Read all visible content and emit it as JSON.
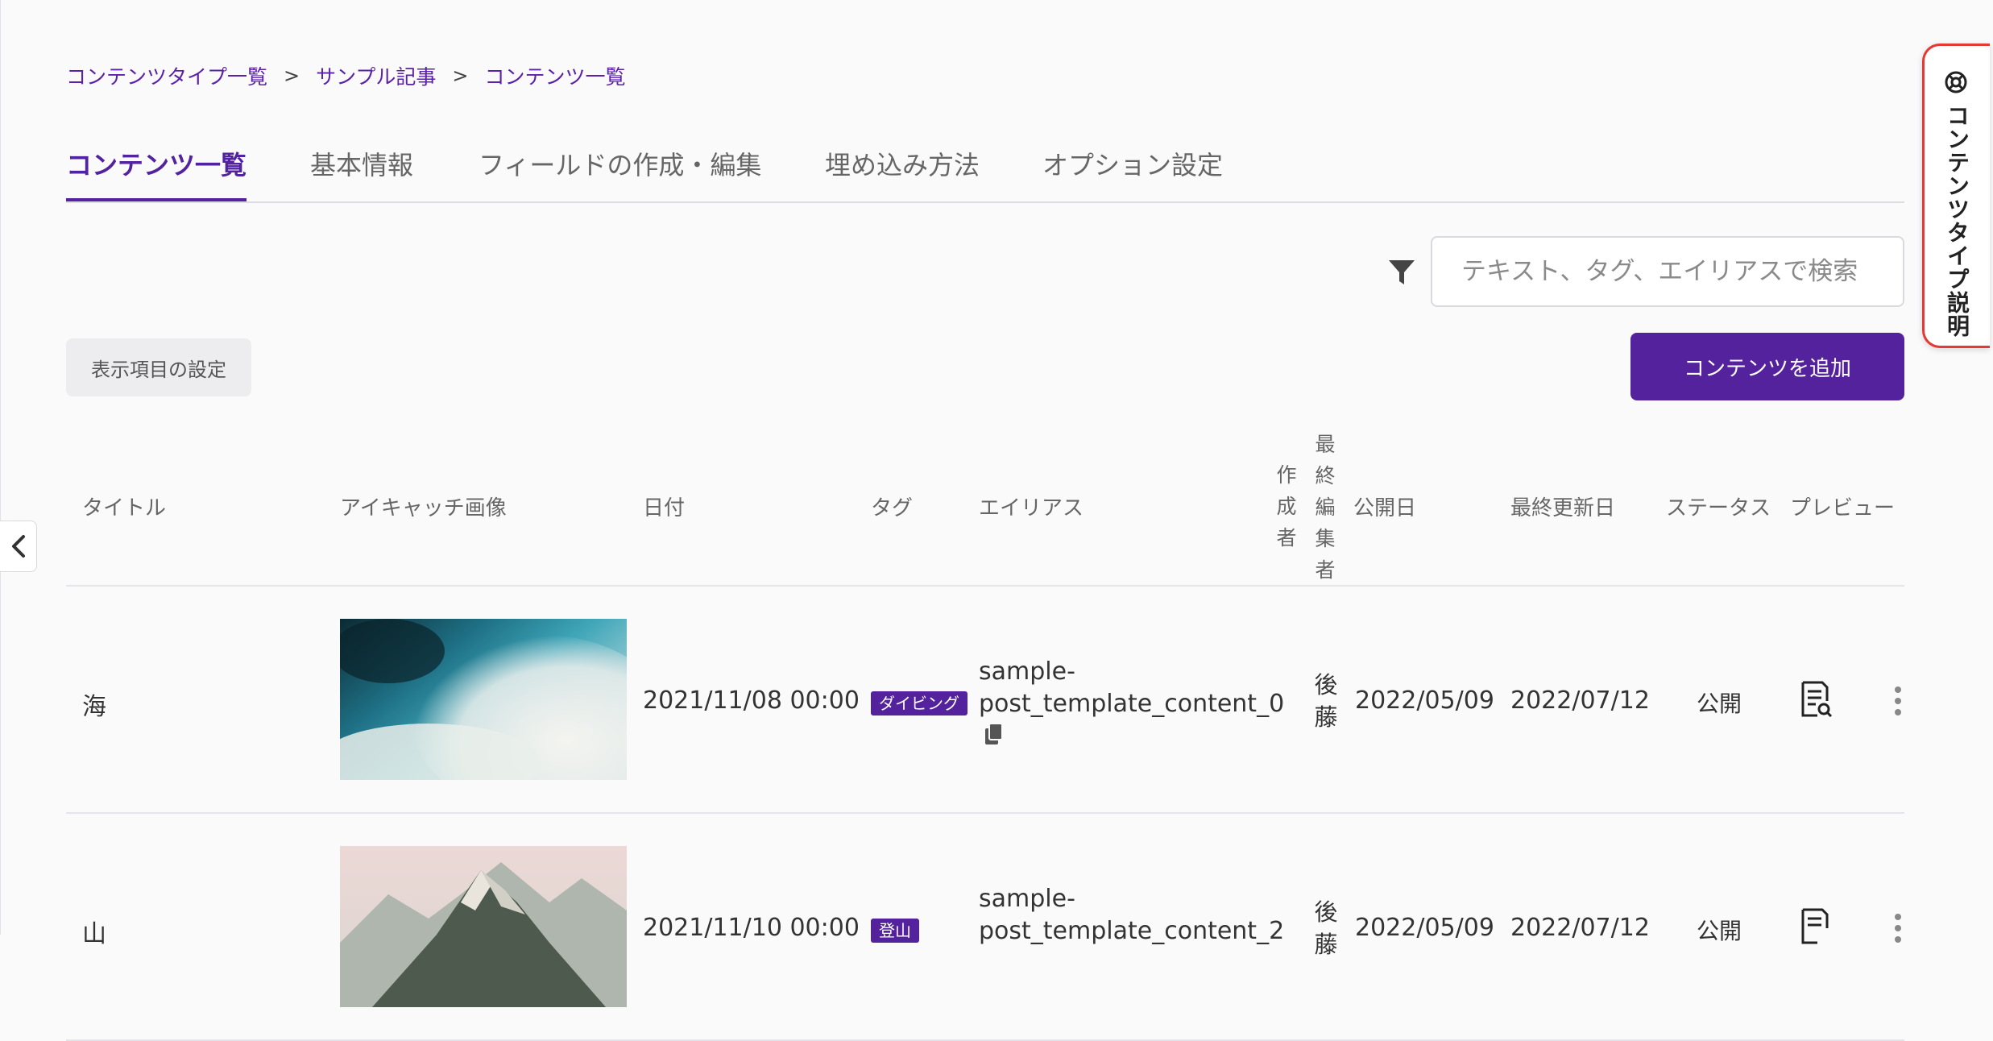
{
  "breadcrumb": [
    "コンテンツタイプ一覧",
    "サンプル記事",
    "コンテンツ一覧"
  ],
  "breadcrumb_separator": ">",
  "tabs": [
    {
      "label": "コンテンツ一覧",
      "active": true
    },
    {
      "label": "基本情報",
      "active": false
    },
    {
      "label": "フィールドの作成・編集",
      "active": false
    },
    {
      "label": "埋め込み方法",
      "active": false
    },
    {
      "label": "オプション設定",
      "active": false
    }
  ],
  "search": {
    "placeholder": "テキスト、タグ、エイリアスで検索"
  },
  "toolbar": {
    "display_settings_label": "表示項目の設定",
    "add_content_label": "コンテンツを追加"
  },
  "side_panel": {
    "label": "コンテンツタイプ説明",
    "icon": "help-circle-icon"
  },
  "table": {
    "columns": {
      "title": "タイトル",
      "eyecatch": "アイキャッチ画像",
      "date": "日付",
      "tag": "タグ",
      "alias": "エイリアス",
      "author": "作成者",
      "last_editor": "最終編集者",
      "published": "公開日",
      "updated": "最終更新日",
      "status": "ステータス",
      "preview": "プレビュー"
    },
    "rows": [
      {
        "title": "海",
        "date": "2021/11/08 00:00",
        "tag": "ダイビング",
        "alias": "sample-post_template_content_0",
        "alias_line1": "sample-",
        "alias_line2": "post_template_content_0",
        "last_editor": "後藤",
        "published": "2022/05/09",
        "updated": "2022/07/12",
        "status": "公開",
        "image": "ocean-waves"
      },
      {
        "title": "山",
        "date": "2021/11/10 00:00",
        "tag": "登山",
        "alias": "sample-post_template_content_2",
        "alias_line1": "sample-",
        "alias_line2": "post_template_content_2",
        "last_editor": "後藤",
        "published": "2022/05/09",
        "updated": "2022/07/12",
        "status": "公開",
        "image": "mountain-peak"
      }
    ]
  },
  "colors": {
    "accent": "#55229e",
    "side_panel_border": "#e53935"
  }
}
